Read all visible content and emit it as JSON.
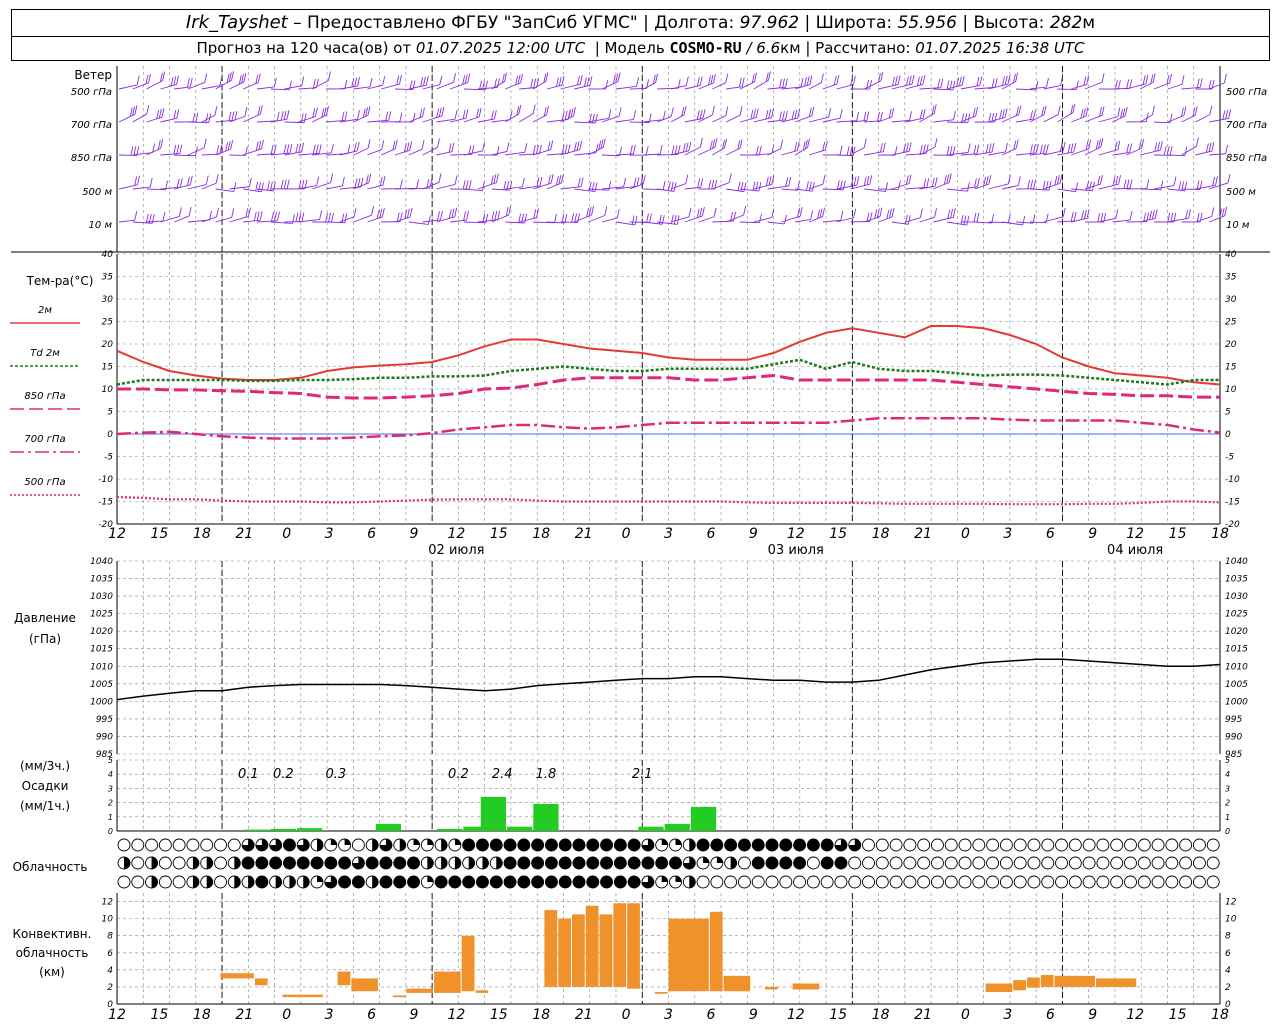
{
  "header": {
    "station": "Irk_Tayshet",
    "provided_by": " – Предоставлено ФГБУ \"ЗапСиб УГМС\" | Долгота: ",
    "longitude": "97.962",
    "lat_label": " | Широта: ",
    "latitude": "55.956",
    "alt_label": " | Высота: ",
    "altitude": "282",
    "altitude_unit": "м",
    "forecast_prefix": "Прогноз на 120 часа(ов) от ",
    "forecast_start": "01.07.2025 12:00 UTC",
    "model_prefix": "  | Модель ",
    "model": "COSMO-RU",
    "model_res": " / 6.6",
    "model_res_unit": "км",
    "calc_prefix": " | Рассчитано: ",
    "calc_time": "01.07.2025 16:38 UTC"
  },
  "wind_panel": {
    "title": "Ветер",
    "levels": [
      {
        "label": "500 гПа",
        "right": "500 гПа"
      },
      {
        "label": "700 гПа",
        "right": "700 гПа"
      },
      {
        "label": "850 гПа",
        "right": "850 гПа"
      },
      {
        "label": "500 м",
        "right": "500 м"
      },
      {
        "label": "10  м",
        "right": "10  м"
      }
    ],
    "barb_color": "#8a2be2"
  },
  "time_axis": {
    "hour_labels": [
      "12",
      "15",
      "18",
      "21",
      "0",
      "3",
      "6",
      "9",
      "12",
      "15",
      "18",
      "21",
      "0",
      "3",
      "6",
      "9",
      "12",
      "15",
      "18",
      "21",
      "0",
      "3",
      "6",
      "9",
      "12",
      "15",
      "18"
    ],
    "day_labels": [
      {
        "text": "02 июля",
        "at_index": 8
      },
      {
        "text": "03 июля",
        "at_index": 16
      },
      {
        "text": "04 июля",
        "at_index": 24
      }
    ]
  },
  "chart_data": [
    {
      "type": "line",
      "title": "Тем-ра(°C)",
      "ylim": [
        -20,
        40
      ],
      "yticks": [
        40,
        35,
        30,
        25,
        20,
        15,
        10,
        5,
        0,
        -5,
        -10,
        -15,
        -20
      ],
      "x_hours": [
        0,
        3,
        6,
        9,
        12,
        15,
        18,
        21,
        24,
        27,
        30,
        33,
        36,
        39,
        42,
        45,
        48,
        51,
        54,
        57,
        60,
        63,
        66,
        69,
        72,
        75,
        78,
        81,
        84,
        87,
        90,
        93,
        96,
        99,
        102,
        105,
        108,
        111,
        114,
        117,
        120,
        123,
        126
      ],
      "series": [
        {
          "name": "2м",
          "color": "#e53935",
          "dash": "solid",
          "values": [
            18.5,
            16,
            14,
            13,
            12.3,
            12,
            12,
            12.5,
            14,
            14.8,
            15.2,
            15.5,
            16,
            17.5,
            19.5,
            21,
            21,
            20,
            19,
            18.5,
            18,
            17,
            16.5,
            16.5,
            16.5,
            18,
            20.5,
            22.5,
            23.5,
            22.5,
            21.5,
            24,
            24,
            23.5,
            22,
            20,
            17,
            15,
            13.5,
            13,
            12.5,
            11.5,
            11
          ]
        },
        {
          "name": "Td  2м",
          "color": "#1b7a1b",
          "dash": "dotted",
          "values": [
            11,
            12,
            12,
            12,
            12,
            11.8,
            11.8,
            12,
            12,
            12.2,
            12.5,
            12.5,
            12.8,
            12.8,
            13,
            14,
            14.5,
            15,
            14.5,
            14,
            14,
            14.5,
            14.5,
            14.5,
            14.5,
            15.5,
            16.5,
            14.5,
            16,
            14.5,
            14,
            14,
            13.5,
            13,
            13.2,
            13.2,
            13,
            12.5,
            12,
            11.5,
            11,
            12,
            12
          ]
        },
        {
          "name": "850 гПа",
          "color": "#e0287a",
          "dash": "dashed",
          "values": [
            10,
            10,
            9.8,
            9.8,
            9.6,
            9.5,
            9.2,
            9,
            8.2,
            8,
            8,
            8.2,
            8.5,
            9,
            10,
            10.2,
            11,
            12,
            12.5,
            12.5,
            12.5,
            12.5,
            12,
            12,
            12.5,
            13,
            12,
            12,
            12,
            12,
            12,
            12,
            11.5,
            11,
            10.5,
            10,
            9.5,
            9,
            8.8,
            8.5,
            8.5,
            8.2,
            8.2
          ]
        },
        {
          "name": "700 гПа",
          "color": "#e0287a",
          "dash": "dashdot",
          "values": [
            0,
            0.3,
            0.5,
            0,
            -0.5,
            -0.8,
            -1,
            -1,
            -1,
            -0.8,
            -0.5,
            -0.3,
            0.2,
            1,
            1.5,
            2,
            2,
            1.5,
            1.2,
            1.5,
            2,
            2.5,
            2.5,
            2.5,
            2.5,
            2.5,
            2.5,
            2.5,
            3,
            3.5,
            3.5,
            3.5,
            3.5,
            3.5,
            3.2,
            3,
            3,
            3,
            3,
            2.5,
            2,
            1,
            0.3
          ]
        },
        {
          "name": "500 гПа",
          "color": "#e0287a",
          "dash": "finedot",
          "values": [
            -14,
            -14.2,
            -14.5,
            -14.5,
            -14.8,
            -15,
            -15,
            -15,
            -15.2,
            -15.2,
            -15,
            -14.8,
            -14.6,
            -14.5,
            -14.5,
            -14.5,
            -14.8,
            -15,
            -15,
            -15,
            -15,
            -15,
            -15,
            -15,
            -15.2,
            -15.3,
            -15.3,
            -15.3,
            -15.3,
            -15.4,
            -15.5,
            -15.5,
            -15.5,
            -15.5,
            -15.6,
            -15.6,
            -15.6,
            -15.5,
            -15.5,
            -15.3,
            -15,
            -15,
            -15.2
          ]
        }
      ]
    },
    {
      "type": "line",
      "title": "Давление",
      "ylabel": "(гПа)",
      "ylim": [
        985,
        1040
      ],
      "yticks": [
        1040,
        1035,
        1030,
        1025,
        1020,
        1015,
        1010,
        1005,
        1000,
        995,
        990,
        985
      ],
      "series": [
        {
          "name": "pressure",
          "color": "#000000",
          "values": [
            1000.5,
            1001.5,
            1002.3,
            1003,
            1003,
            1004,
            1004.5,
            1004.8,
            1004.8,
            1004.8,
            1004.8,
            1004.5,
            1004,
            1003.5,
            1003,
            1003.5,
            1004.5,
            1005,
            1005.5,
            1006,
            1006.5,
            1006.5,
            1007,
            1007,
            1006.5,
            1006,
            1006,
            1005.5,
            1005.5,
            1006,
            1007.5,
            1009,
            1010,
            1011,
            1011.5,
            1012,
            1012,
            1011.5,
            1011,
            1010.5,
            1010,
            1010,
            1010.5
          ]
        }
      ]
    },
    {
      "type": "bar",
      "title": "Осадки",
      "ylabel_top": "(мм/3ч.)",
      "ylabel_bottom": "(мм/1ч.)",
      "ylim": [
        0,
        5
      ],
      "yticks": [
        5,
        4,
        3,
        2,
        1,
        0
      ],
      "color": "#22cc22",
      "bars": [
        {
          "hour": 16,
          "value": 0.1
        },
        {
          "hour": 19,
          "value": 0.15
        },
        {
          "hour": 22,
          "value": 0.2
        },
        {
          "hour": 31,
          "value": 0.5
        },
        {
          "hour": 38,
          "value": 0.15
        },
        {
          "hour": 41,
          "value": 0.3
        },
        {
          "hour": 43,
          "value": 2.4
        },
        {
          "hour": 46,
          "value": 0.3
        },
        {
          "hour": 49,
          "value": 1.9
        },
        {
          "hour": 61,
          "value": 0.3
        },
        {
          "hour": 64,
          "value": 0.5
        },
        {
          "hour": 67,
          "value": 1.7
        }
      ],
      "labels": [
        {
          "hour": 15,
          "text": "0.1"
        },
        {
          "hour": 19,
          "text": "0.2"
        },
        {
          "hour": 25,
          "text": "0.3"
        },
        {
          "hour": 39,
          "text": "0.2"
        },
        {
          "hour": 44,
          "text": "2.4"
        },
        {
          "hour": 49,
          "text": "1.8"
        },
        {
          "hour": 60,
          "text": "2.1"
        }
      ]
    },
    {
      "type": "bar",
      "title": "Конвективн. облачность (км)",
      "title_lines": [
        "Конвективн.",
        "облачность",
        "(км)"
      ],
      "ylim": [
        0,
        13
      ],
      "yticks": [
        12,
        10,
        8,
        6,
        4,
        2,
        0
      ],
      "color": "#f0922b",
      "bars": [
        {
          "from": 7.5,
          "to": 10,
          "base": 3,
          "top": 3.6
        },
        {
          "from": 10,
          "to": 11,
          "base": 2.2,
          "top": 3
        },
        {
          "from": 12,
          "to": 15,
          "base": 0.8,
          "top": 1.1
        },
        {
          "from": 16,
          "to": 17,
          "base": 2.2,
          "top": 3.8
        },
        {
          "from": 17,
          "to": 19,
          "base": 1.5,
          "top": 3
        },
        {
          "from": 20,
          "to": 21,
          "base": 0.8,
          "top": 1
        },
        {
          "from": 21,
          "to": 23,
          "base": 1.3,
          "top": 1.8
        },
        {
          "from": 23,
          "to": 25,
          "base": 1.3,
          "top": 3.8
        },
        {
          "from": 25,
          "to": 26,
          "base": 1.5,
          "top": 8
        },
        {
          "from": 26,
          "to": 27,
          "base": 1.3,
          "top": 1.6
        },
        {
          "from": 31,
          "to": 32,
          "base": 2,
          "top": 11
        },
        {
          "from": 32,
          "to": 33,
          "base": 2,
          "top": 10
        },
        {
          "from": 33,
          "to": 34,
          "base": 2,
          "top": 10.5
        },
        {
          "from": 34,
          "to": 35,
          "base": 2,
          "top": 11.5
        },
        {
          "from": 35,
          "to": 36,
          "base": 2,
          "top": 10.5
        },
        {
          "from": 36,
          "to": 37,
          "base": 2,
          "top": 11.8
        },
        {
          "from": 37,
          "to": 38,
          "base": 1.8,
          "top": 11.8
        },
        {
          "from": 39,
          "to": 40,
          "base": 1.2,
          "top": 1.4
        },
        {
          "from": 40,
          "to": 43,
          "base": 1.5,
          "top": 10
        },
        {
          "from": 43,
          "to": 44,
          "base": 1.5,
          "top": 10.8
        },
        {
          "from": 44,
          "to": 46,
          "base": 1.5,
          "top": 3.3
        },
        {
          "from": 47,
          "to": 48,
          "base": 1.7,
          "top": 2
        },
        {
          "from": 49,
          "to": 51,
          "base": 1.7,
          "top": 2.4
        },
        {
          "from": 63,
          "to": 65,
          "base": 1.4,
          "top": 2.4
        },
        {
          "from": 65,
          "to": 66,
          "base": 1.6,
          "top": 2.8
        },
        {
          "from": 66,
          "to": 67,
          "base": 1.9,
          "top": 3.1
        },
        {
          "from": 67,
          "to": 68,
          "base": 2,
          "top": 3.4
        },
        {
          "from": 68,
          "to": 71,
          "base": 2,
          "top": 3.3
        },
        {
          "from": 71,
          "to": 74,
          "base": 2,
          "top": 3
        }
      ]
    }
  ],
  "cloud_panel": {
    "title": "Облачность",
    "rows": [
      "000000000333432110232112144444444444443112444444444433000000000000000000000000000000000000000000002004140",
      "202002202444444443444422222244444444444443112044440440000000000000000000000000000000000000000002400",
      "002002202242221344244414444444444444443112000000000000000000000000000000000000000000000000000000000"
    ]
  },
  "colors": {
    "grid": "#888888",
    "axis": "#000000",
    "blue_zero": "#1e3fdc"
  }
}
